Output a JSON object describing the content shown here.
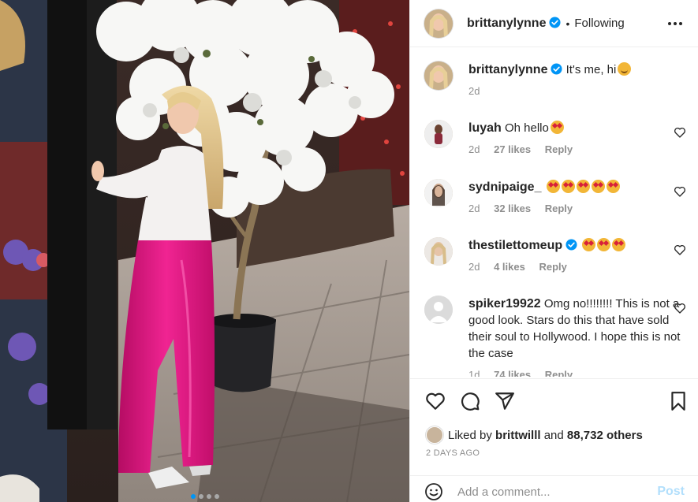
{
  "photo": {
    "description_icons": "photo",
    "carousel": {
      "total": 4,
      "active": 1
    }
  },
  "header": {
    "username": "brittanylynne",
    "separator": "•",
    "follow_label": "Following"
  },
  "caption": {
    "username": "brittanylynne",
    "text": "It's me, hi",
    "time": "2d"
  },
  "comments": [
    {
      "username": "luyah",
      "text": "Oh hello",
      "time": "2d",
      "likes": "27 likes",
      "reply": "Reply"
    },
    {
      "username": "sydnipaige_",
      "text": "",
      "time": "2d",
      "likes": "32 likes",
      "reply": "Reply"
    },
    {
      "username": "thestilettomeup",
      "text": "",
      "time": "2d",
      "likes": "4 likes",
      "reply": "Reply"
    },
    {
      "username": "spiker19922",
      "text": "Omg no!!!!!!!! This is not a good look. Stars do this that have sold their soul to Hollywood. I hope this is not the case",
      "time": "1d",
      "likes": "74 likes",
      "reply": "Reply"
    }
  ],
  "engagement": {
    "liked_by_prefix": "Liked by",
    "liked_by_user": "brittwilll",
    "liked_by_suffix": "and",
    "others": "88,732 others",
    "time_ago": "2 DAYS AGO"
  },
  "composer": {
    "placeholder": "Add a comment...",
    "post_label": "Post"
  },
  "colors": {
    "accent": "#0095f6",
    "verified": "#0095f6",
    "post_disabled": "#b2dffc",
    "pants": "#e4147f"
  },
  "icons": [
    "more-icon",
    "heart-icon",
    "comment-icon",
    "share-icon",
    "bookmark-icon",
    "emoji-icon",
    "verified-icon"
  ]
}
